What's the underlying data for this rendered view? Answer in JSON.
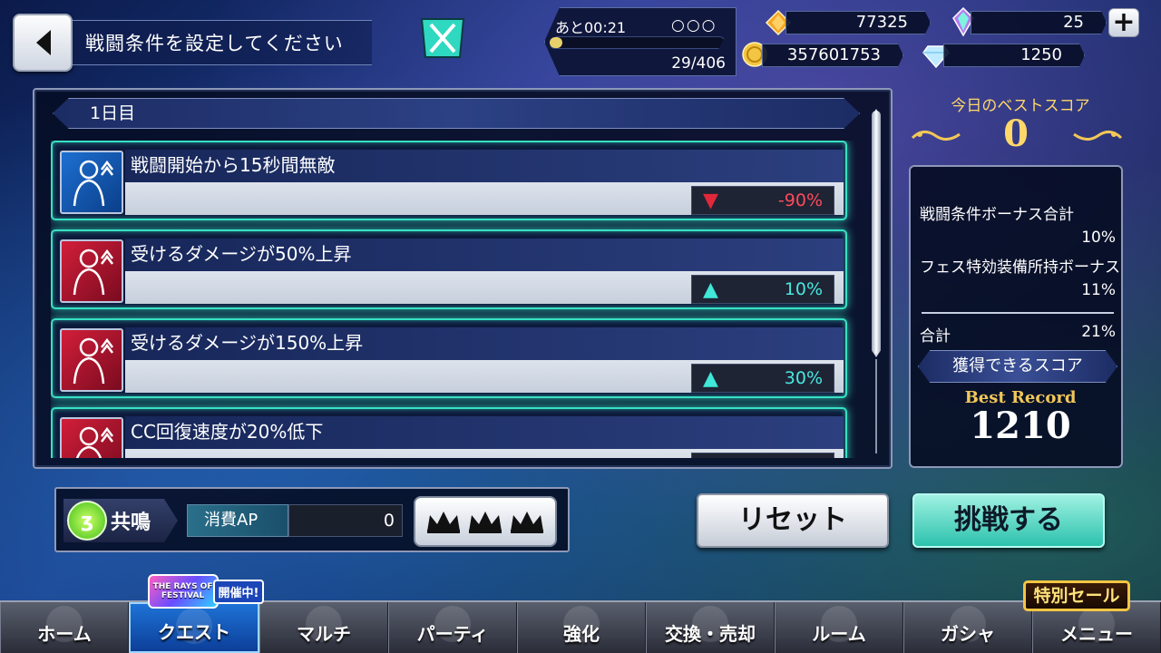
{
  "header": {
    "title": "戦闘条件を設定してください"
  },
  "ap": {
    "time_left": "あと00:21",
    "dots": "○○○",
    "current": 29,
    "max": 406,
    "count_text": "29/406"
  },
  "currencies": {
    "topaz": "77325",
    "crystal": "25",
    "gold": "357601753",
    "diamond": "1250"
  },
  "day_header": "1日目",
  "conditions": [
    {
      "name": "戦闘開始から15秒間無敵",
      "type": "blue",
      "arrow": "▼",
      "arrow_color": "#e0283a",
      "value": "-90%",
      "value_color": "#ff4a5a"
    },
    {
      "name": "受けるダメージが50%上昇",
      "type": "red",
      "arrow": "▲",
      "arrow_color": "#3fe8d8",
      "value": "10%",
      "value_color": "#48e8e0"
    },
    {
      "name": "受けるダメージが150%上昇",
      "type": "red",
      "arrow": "▲",
      "arrow_color": "#3fe8d8",
      "value": "30%",
      "value_color": "#48e8e0"
    },
    {
      "name": "CC回復速度が20%低下",
      "type": "red",
      "arrow": "",
      "arrow_color": "#3fe8d8",
      "value": "",
      "value_color": "#48e8e0"
    }
  ],
  "score": {
    "today_label": "今日のベストスコア",
    "today_value": "0",
    "bonus_total_label": "戦闘条件ボーナス合計",
    "bonus_total_value": "10%",
    "fes_bonus_label": "フェス特効装備所持ボーナス",
    "fes_bonus_value": "11%",
    "sum_label": "合計",
    "sum_value": "21%",
    "get_score_label": "獲得できるスコア",
    "best_record_label": "Best Record",
    "best_record_value": "1210"
  },
  "controls": {
    "resonance_label": "共鳴",
    "ap_cost_label": "消費AP",
    "ap_cost_value": "0",
    "reset_label": "リセット",
    "challenge_label": "挑戦する"
  },
  "nav": {
    "items": [
      "ホーム",
      "クエスト",
      "マルチ",
      "パーティ",
      "強化",
      "交換・売却",
      "ルーム",
      "ガシャ",
      "メニュー"
    ],
    "active_index": 1
  },
  "badges": {
    "festival_logo": "THE RAYS OF FESTIVAL",
    "festival_tag": "開催中!",
    "sale": "特別セール"
  },
  "colors": {
    "accent_teal": "#38e0c3",
    "gold": "#ffd86a"
  }
}
